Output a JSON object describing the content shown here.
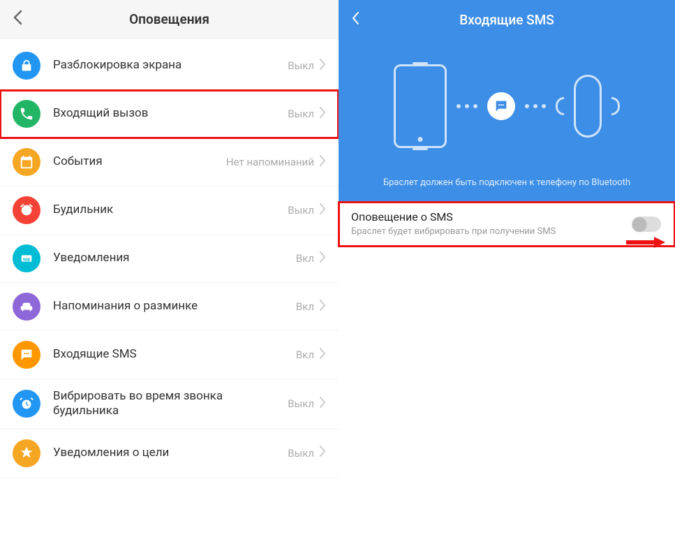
{
  "left": {
    "title": "Оповещения",
    "items": [
      {
        "label": "Разблокировка экрана",
        "status": "Выкл",
        "icon": "lock",
        "color": "#2196f3",
        "highlighted": false
      },
      {
        "label": "Входящий вызов",
        "status": "Выкл",
        "icon": "phone",
        "color": "#23b566",
        "highlighted": true
      },
      {
        "label": "События",
        "status": "Нет напоминаний",
        "icon": "calendar",
        "color": "#f5a623",
        "highlighted": false
      },
      {
        "label": "Будильник",
        "status": "Выкл",
        "icon": "alarm",
        "color": "#f44336",
        "highlighted": false
      },
      {
        "label": "Уведомления",
        "status": "Вкл",
        "icon": "app",
        "color": "#00bcd4",
        "highlighted": false
      },
      {
        "label": "Напоминания о разминке",
        "status": "Вкл",
        "icon": "couch",
        "color": "#8e67d8",
        "highlighted": false
      },
      {
        "label": "Входящие SMS",
        "status": "Вкл",
        "icon": "sms",
        "color": "#ff9800",
        "highlighted": false
      },
      {
        "label": "Вибрировать во время звонка будильника",
        "status": "Выкл",
        "icon": "alarm2",
        "color": "#2196f3",
        "highlighted": false
      },
      {
        "label": "Уведомления о цели",
        "status": "Выкл",
        "icon": "goal",
        "color": "#f5a623",
        "highlighted": false
      }
    ]
  },
  "right": {
    "title": "Входящие SMS",
    "hero_caption": "Браслет должен быть подключен к телефону по Bluetooth",
    "setting": {
      "title": "Оповещение о SMS",
      "subtitle": "Браслет будет вибрировать при получении SMS",
      "enabled": false
    }
  }
}
